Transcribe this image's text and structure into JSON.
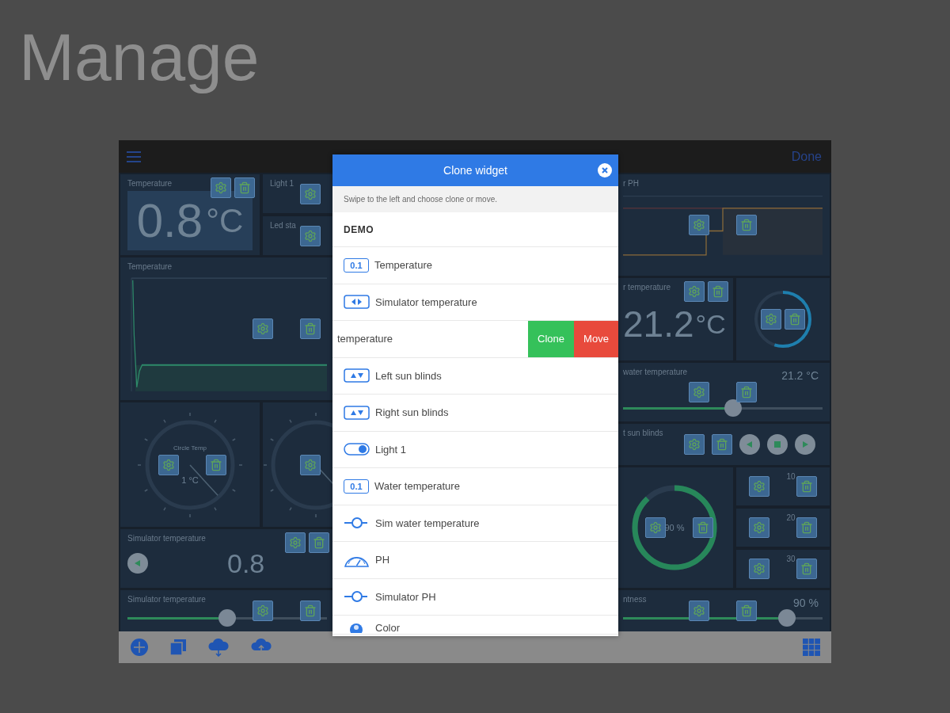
{
  "page_title": "Manage",
  "top_bar": {
    "action": "Done"
  },
  "left": {
    "value_tile": {
      "title": "Temperature",
      "value": "0.8",
      "unit": "°C"
    },
    "switch_tiles": [
      {
        "title": "Light 1"
      },
      {
        "title": "Led sta"
      }
    ],
    "chart_tile": {
      "title": "Temperature"
    },
    "gauge_tiles": [
      {
        "kind": "labeled",
        "caption": "Circle Temp",
        "value": "1 °C"
      },
      {
        "kind": "partial"
      }
    ],
    "player_tile": {
      "title": "Simulator temperature",
      "value": "0.8"
    },
    "slider_tile": {
      "title": "Simulator temperature",
      "level": 0.5
    }
  },
  "right": {
    "chart_tile": {
      "title": "r PH"
    },
    "value_tile": {
      "title": "r temperature",
      "value": "21.2",
      "unit": "°C"
    },
    "slider_tile": {
      "title": "water temperature",
      "reading": "21.2 °C",
      "level": 0.55
    },
    "blinds_tile": {
      "title": "t sun blinds"
    },
    "ring_gauge": {
      "value": "90 %"
    },
    "small_tiles": [
      {
        "value": "10"
      },
      {
        "value": "20"
      },
      {
        "value": "30"
      }
    ],
    "brightness_tile": {
      "title": "ntness",
      "reading": "90 %",
      "level": 0.82
    }
  },
  "dialog": {
    "title": "Clone widget",
    "hint": "Swipe to the left and choose clone or move.",
    "group": "DEMO",
    "items": [
      {
        "kind": "value",
        "badge": "0.1",
        "label": "Temperature"
      },
      {
        "kind": "arrows_lr",
        "label": "Simulator temperature"
      },
      {
        "kind": "swiped",
        "label": "temperature",
        "actions": [
          {
            "kind": "clone",
            "label": "Clone"
          },
          {
            "kind": "move",
            "label": "Move"
          }
        ]
      },
      {
        "kind": "arrows_ud",
        "label": "Left sun blinds"
      },
      {
        "kind": "arrows_ud",
        "label": "Right sun blinds"
      },
      {
        "kind": "toggle",
        "label": "Light 1"
      },
      {
        "kind": "value",
        "badge": "0.1",
        "label": "Water temperature"
      },
      {
        "kind": "slider",
        "label": "Sim water temperature"
      },
      {
        "kind": "gauge",
        "label": "PH"
      },
      {
        "kind": "slider",
        "label": "Simulator PH"
      },
      {
        "kind": "color",
        "label": "Color"
      }
    ]
  }
}
